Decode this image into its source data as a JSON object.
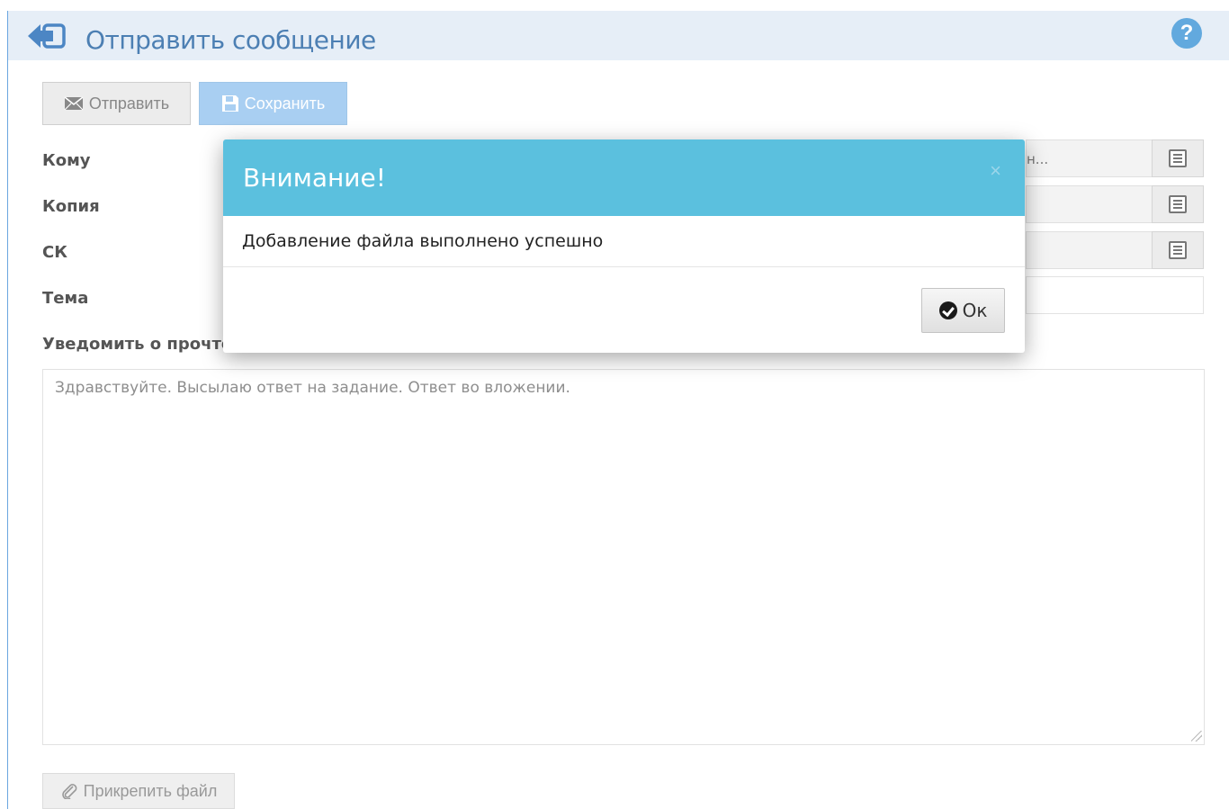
{
  "header": {
    "title": "Отправить сообщение",
    "help_label": "?"
  },
  "toolbar": {
    "send_label": "Отправить",
    "save_label": "Сохранить"
  },
  "form": {
    "to_label": "Кому",
    "to_value": "н...",
    "cc_label": "Копия",
    "bcc_label": "СК",
    "subject_label": "Тема",
    "notify_label": "Уведомить о прочтен",
    "body_text": "Здравствуйте. Высылаю ответ на задание. Ответ во вложении.",
    "attach_label": "Прикрепить файл"
  },
  "modal": {
    "title": "Внимание!",
    "close_label": "×",
    "message": "Добавление файла выполнено успешно",
    "ok_label": "Ок"
  },
  "colors": {
    "header_bg": "#e6eef7",
    "title_color": "#4c7fb3",
    "modal_header": "#5bc0de",
    "save_button": "#a9cff2"
  }
}
